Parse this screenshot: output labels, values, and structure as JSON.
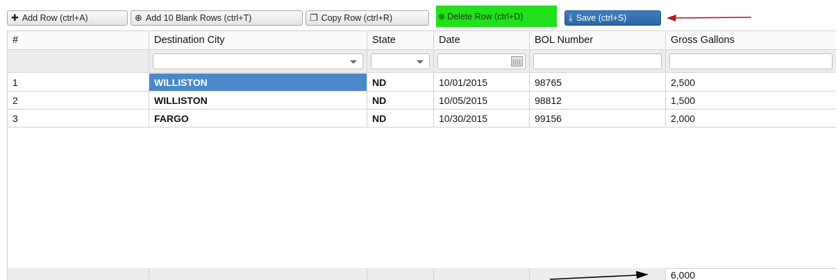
{
  "toolbar": {
    "add_row": {
      "icon": "plus-icon",
      "label": "Add Row (ctrl+A)"
    },
    "add_blank_rows": {
      "icon": "plus-circle-icon",
      "label": "Add 10 Blank Rows (ctrl+T)"
    },
    "copy_row": {
      "icon": "copy-icon",
      "label": "Copy Row (ctrl+R)"
    },
    "delete_row": {
      "icon": "x-circle-icon",
      "label": "Delete Row (ctrl+D)",
      "highlight_color": "#22e01c"
    },
    "save": {
      "icon": "save-icon",
      "label": "Save (ctrl+S)",
      "color": "#2f6aa8"
    }
  },
  "annotations": {
    "red_arrow_color": "#b3141e",
    "black_arrow_color": "#000000"
  },
  "grid": {
    "columns": [
      "#",
      "Destination City",
      "State",
      "Date",
      "BOL Number",
      "Gross Gallons"
    ],
    "rows": [
      {
        "num": "1",
        "city": "WILLISTON",
        "state": "ND",
        "date": "10/01/2015",
        "bol": "98765",
        "gallons": "2,500",
        "selected_cell": "city"
      },
      {
        "num": "2",
        "city": "WILLISTON",
        "state": "ND",
        "date": "10/05/2015",
        "bol": "98812",
        "gallons": "1,500"
      },
      {
        "num": "3",
        "city": "FARGO",
        "state": "ND",
        "date": "10/30/2015",
        "bol": "99156",
        "gallons": "2,000"
      }
    ],
    "footer": {
      "gross_gallons_total": "6,000"
    },
    "selection_color": "#4a88c9"
  }
}
